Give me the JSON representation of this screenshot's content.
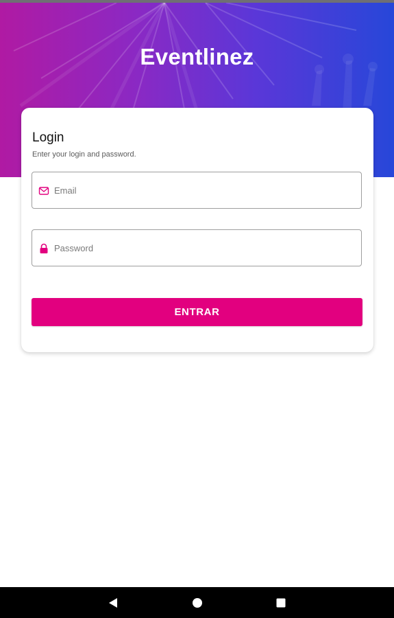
{
  "app": {
    "title": "Eventlinez"
  },
  "login": {
    "title": "Login",
    "subtitle": "Enter your login and password.",
    "email": {
      "placeholder": "Email",
      "value": "",
      "icon": "mail-icon"
    },
    "password": {
      "placeholder": "Password",
      "value": "",
      "icon": "lock-icon"
    },
    "submit_label": "ENTRAR"
  },
  "navigation": {
    "buttons": [
      "back-icon",
      "home-icon",
      "recents-icon"
    ]
  },
  "colors": {
    "accent": "#e2007f",
    "header_gradient_start": "#b01aa3",
    "header_gradient_end": "#2747d9"
  }
}
